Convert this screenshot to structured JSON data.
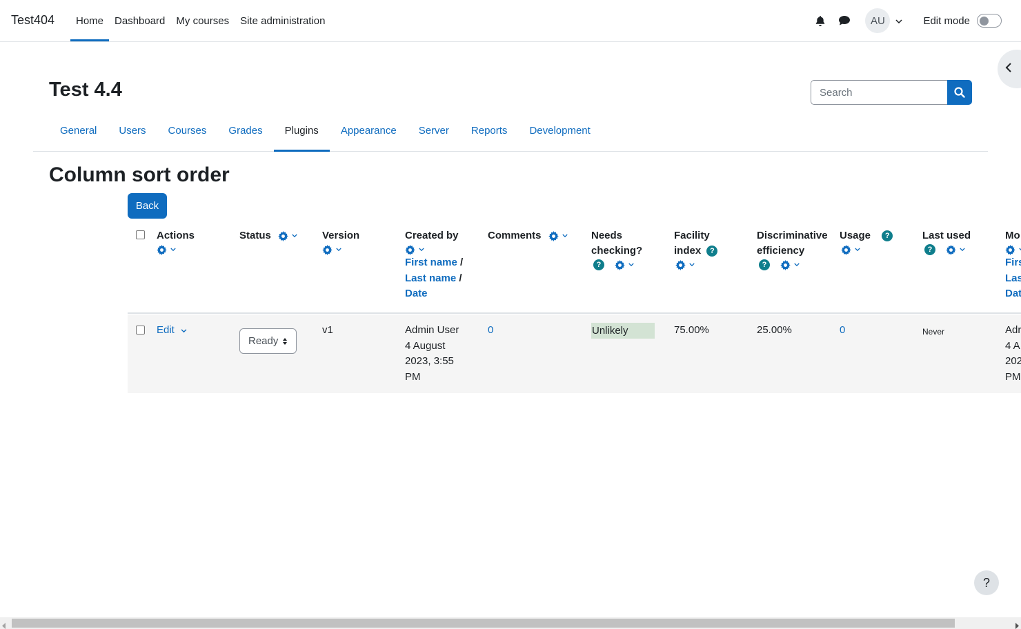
{
  "navbar": {
    "brand": "Test404",
    "items": [
      {
        "label": "Home",
        "active": true
      },
      {
        "label": "Dashboard",
        "active": false
      },
      {
        "label": "My courses",
        "active": false
      },
      {
        "label": "Site administration",
        "active": false
      }
    ],
    "avatar": "AU",
    "edit_mode_label": "Edit mode",
    "edit_mode_on": false
  },
  "header": {
    "title": "Test 4.4",
    "search_placeholder": "Search"
  },
  "tabs": [
    {
      "label": "General",
      "active": false
    },
    {
      "label": "Users",
      "active": false
    },
    {
      "label": "Courses",
      "active": false
    },
    {
      "label": "Grades",
      "active": false
    },
    {
      "label": "Plugins",
      "active": true
    },
    {
      "label": "Appearance",
      "active": false
    },
    {
      "label": "Server",
      "active": false
    },
    {
      "label": "Reports",
      "active": false
    },
    {
      "label": "Development",
      "active": false
    }
  ],
  "page_heading": "Column sort order",
  "back_label": "Back",
  "table": {
    "headers": {
      "actions": "Actions",
      "status": "Status",
      "version": "Version",
      "created_by": "Created by",
      "first_name": "First name",
      "last_name": "Last name",
      "date": "Date",
      "comments": "Comments",
      "needs_checking_1": "Needs",
      "needs_checking_2": "checking?",
      "facility_1": "Facility",
      "facility_2": "index",
      "discrim_1": "Discriminative",
      "discrim_2": "efficiency",
      "usage": "Usage",
      "last_used": "Last used",
      "modified_trunc": "Mo",
      "first_trunc": "Firs",
      "last_trunc": "Las",
      "date_trunc": "Dat"
    },
    "row": {
      "edit_label": "Edit",
      "status_value": "Ready",
      "version": "v1",
      "created_name": "Admin User",
      "created_date_1": "4 August",
      "created_date_2": "2023, 3:55",
      "created_date_3": "PM",
      "comments": "0",
      "needs_checking": "Unlikely",
      "facility_index": "75.00%",
      "discriminative_efficiency": "25.00%",
      "usage": "0",
      "last_used": "Never",
      "modified_1": "Adr",
      "modified_2": "4 A",
      "modified_3": "202",
      "modified_4": "PM"
    }
  },
  "help_fab": "?",
  "colors": {
    "primary": "#0f6cbf",
    "help_badge": "#0f7e8c",
    "unlikely_bg": "#d3e3d4"
  }
}
